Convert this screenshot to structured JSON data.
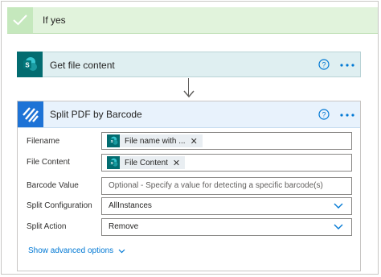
{
  "condition": {
    "label": "If yes"
  },
  "get_file_card": {
    "title": "Get file content"
  },
  "split_card": {
    "title": "Split PDF by Barcode",
    "fields": {
      "filename": {
        "label": "Filename",
        "token": "File name with ..."
      },
      "file_content": {
        "label": "File Content",
        "token": "File Content"
      },
      "barcode_value": {
        "label": "Barcode Value",
        "placeholder": "Optional - Specify a value for detecting a specific barcode(s)"
      },
      "split_configuration": {
        "label": "Split Configuration",
        "value": "AllInstances"
      },
      "split_action": {
        "label": "Split Action",
        "value": "Remove"
      }
    },
    "advanced_options": "Show advanced options"
  },
  "icons": {
    "checkmark": "check-icon",
    "sharepoint": "sharepoint-icon",
    "split": "split-pdf-icon",
    "help": "help-icon",
    "more": "ellipsis-icon",
    "remove": "remove-token-icon",
    "dropdown": "chevron-down-icon"
  },
  "colors": {
    "condition_bg": "#e1f3dc",
    "sharepoint": "#036c70",
    "split_icon": "#1e73d6",
    "accent": "#0078d4"
  }
}
